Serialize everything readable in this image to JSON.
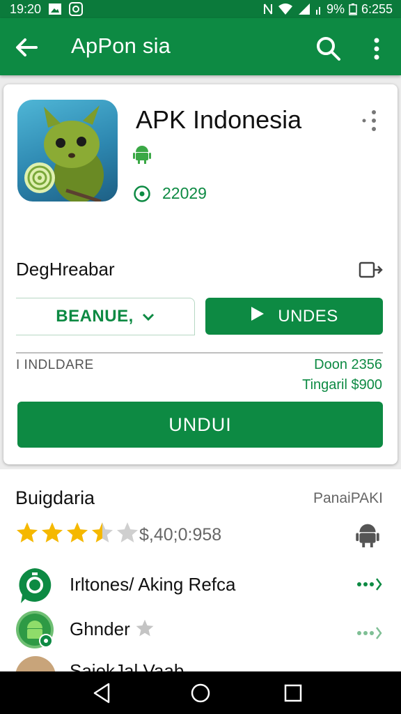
{
  "status_bar": {
    "time": "19:20",
    "battery": "9%",
    "time_right": "6:255"
  },
  "app_bar": {
    "title": "ApPon sia",
    "back_icon": "arrow-left-icon",
    "search_icon": "search-icon",
    "more_icon": "more-vert-icon"
  },
  "app": {
    "name": "APK Indonesia",
    "install_count": "22029",
    "section_label": "DegHreabar",
    "outline_button": "BEANUE,",
    "play_button": "UNDES",
    "info_left": "I INDLDARE",
    "info_right_1": "Doon 2356",
    "info_right_2": "Tingaril $900",
    "main_button": "UNDUI"
  },
  "details": {
    "title": "Buigdaria",
    "link": "PanaiPAKI",
    "rating": 3.5,
    "rating_text": "$,40;0:958",
    "rows": [
      {
        "label": "Irltones/ Aking Refca",
        "icon": "green-badge-icon"
      },
      {
        "label": "Ghnder",
        "icon": "android-circle-icon"
      }
    ],
    "partial_row": "SaiekJal Vaab"
  },
  "nav": {
    "back": "nav-back-icon",
    "home": "nav-home-icon",
    "recents": "nav-recents-icon"
  },
  "colors": {
    "primary": "#0d8a43",
    "statusbar": "#0b7a3b",
    "star": "#f5b800"
  }
}
